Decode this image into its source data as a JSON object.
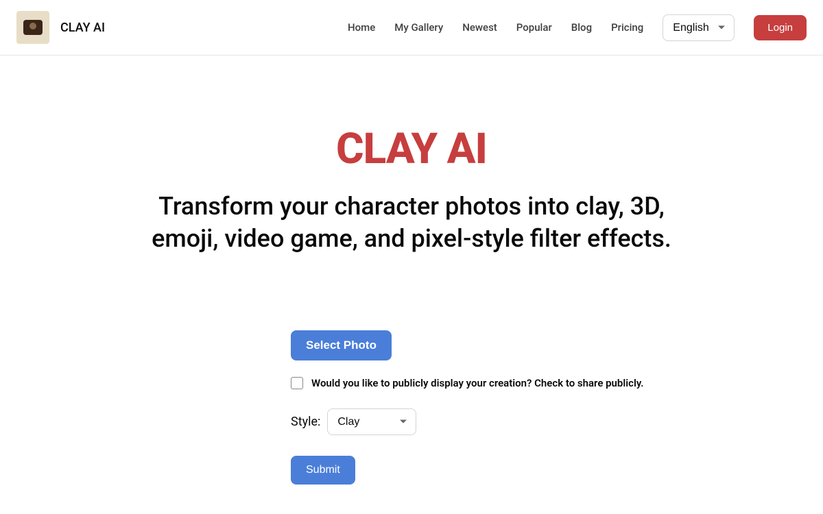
{
  "header": {
    "brand_name": "CLAY AI",
    "nav_items": [
      {
        "label": "Home"
      },
      {
        "label": "My Gallery"
      },
      {
        "label": "Newest"
      },
      {
        "label": "Popular"
      },
      {
        "label": "Blog"
      },
      {
        "label": "Pricing"
      }
    ],
    "language_selected": "English",
    "login_label": "Login"
  },
  "hero": {
    "title": "CLAY AI",
    "subtitle": "Transform your character photos into clay, 3D, emoji, video game, and pixel-style filter effects."
  },
  "form": {
    "select_photo_label": "Select Photo",
    "checkbox_label": "Would you like to publicly display your creation? Check to share publicly.",
    "style_label": "Style:",
    "style_selected": "Clay",
    "submit_label": "Submit"
  }
}
